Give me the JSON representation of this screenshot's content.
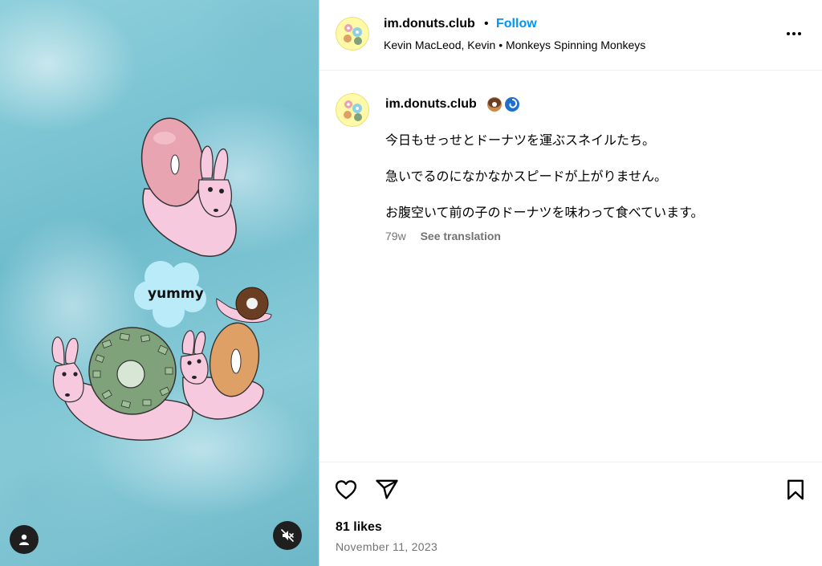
{
  "header": {
    "username": "im.donuts.club",
    "separator": "•",
    "follow_label": "Follow",
    "audio": "Kevin MacLeod, Kevin • Monkeys Spinning Monkeys"
  },
  "media": {
    "bubble_text": "yummy"
  },
  "caption": {
    "username": "im.donuts.club",
    "lines": [
      "今日もせっせとドーナツを運ぶスネイルたち。",
      "急いでるのになかなかスピードが上がりません。",
      "お腹空いて前の子のドーナツを味わって食べています。"
    ],
    "age": "79w",
    "translate_label": "See translation"
  },
  "footer": {
    "likes": "81 likes",
    "date": "November 11, 2023"
  },
  "colors": {
    "accent": "#0095f6",
    "muted": "#737373",
    "avatar_bg": "#fff9a8"
  },
  "icons": [
    "person-tag-icon",
    "mute-icon",
    "more-options-icon",
    "heart-icon",
    "share-icon",
    "bookmark-icon",
    "donut-emoji",
    "cyclone-emoji"
  ]
}
